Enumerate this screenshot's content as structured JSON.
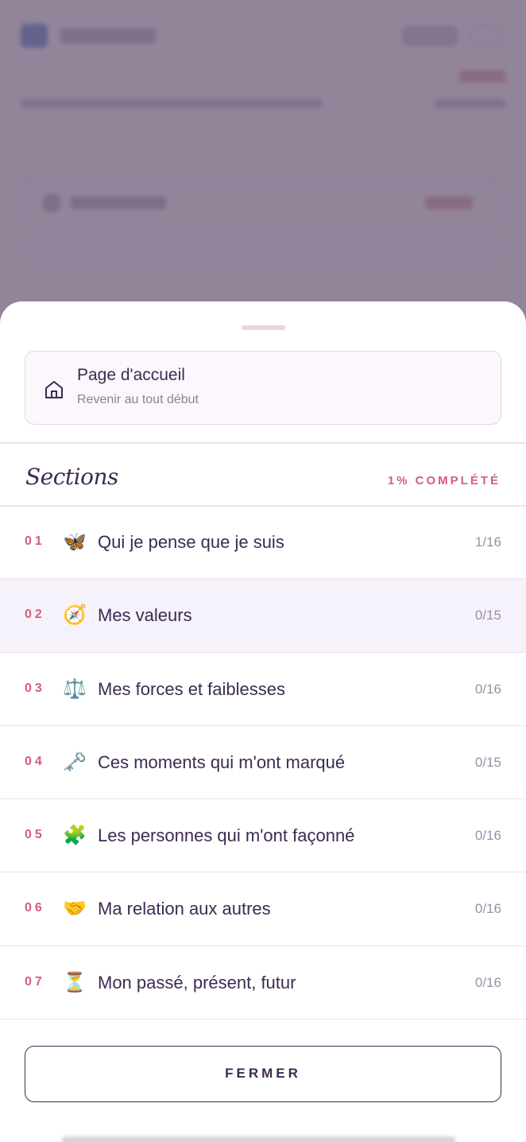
{
  "home": {
    "title": "Page d'accueil",
    "subtitle": "Revenir au tout début",
    "icon": "home-icon"
  },
  "sections": {
    "title": "Sections",
    "progress_label": "1% COMPLÉTÉ",
    "items": [
      {
        "num": "01",
        "emoji": "🦋",
        "icon": "butterfly-icon",
        "label": "Qui je pense que je suis",
        "count": "1/16",
        "active": false
      },
      {
        "num": "02",
        "emoji": "🧭",
        "icon": "compass-icon",
        "label": "Mes valeurs",
        "count": "0/15",
        "active": true
      },
      {
        "num": "03",
        "emoji": "⚖️",
        "icon": "scales-icon",
        "label": "Mes forces et faiblesses",
        "count": "0/16",
        "active": false
      },
      {
        "num": "04",
        "emoji": "🗝️",
        "icon": "key-icon",
        "label": "Ces moments qui m'ont marqué",
        "count": "0/15",
        "active": false
      },
      {
        "num": "05",
        "emoji": "🧩",
        "icon": "puzzle-icon",
        "label": "Les personnes qui m'ont façonné",
        "count": "0/16",
        "active": false
      },
      {
        "num": "06",
        "emoji": "🤝",
        "icon": "handshake-icon",
        "label": "Ma relation aux autres",
        "count": "0/16",
        "active": false
      },
      {
        "num": "07",
        "emoji": "⏳",
        "icon": "hourglass-icon",
        "label": "Mon passé, présent, futur",
        "count": "0/16",
        "active": false
      }
    ]
  },
  "close_button": {
    "label": "FERMER"
  },
  "colors": {
    "accent": "#d45e7a",
    "primary_text": "#3d2a52",
    "active_row": "#f5f2fb",
    "overlay": "#463255"
  }
}
